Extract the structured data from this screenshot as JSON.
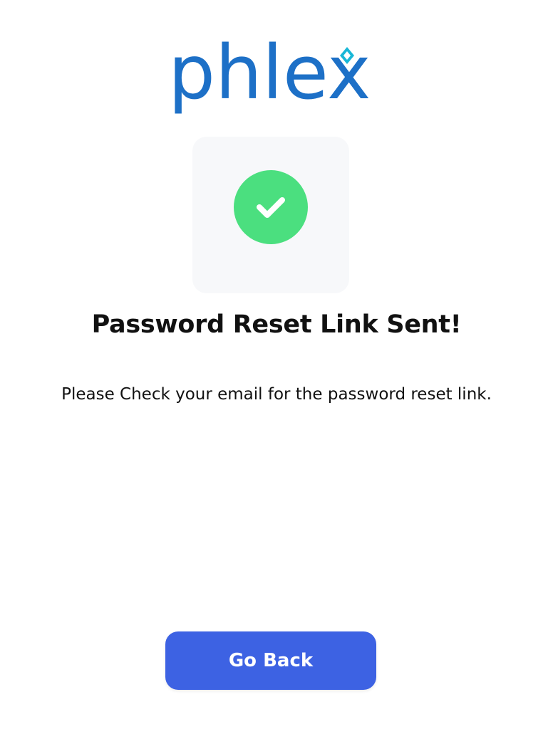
{
  "logo": {
    "text": "phlex",
    "icon": "diamond-icon",
    "brand_color": "#1d70c7",
    "accent_color": "#19b7d7"
  },
  "status": {
    "icon": "check-icon",
    "icon_color": "#4bdf7f",
    "card_color": "#f7f8fa"
  },
  "content": {
    "title": "Password Reset Link Sent!",
    "message": "Please Check your email for the password reset link."
  },
  "actions": {
    "go_back_label": "Go Back",
    "button_color": "#3d62e3"
  }
}
